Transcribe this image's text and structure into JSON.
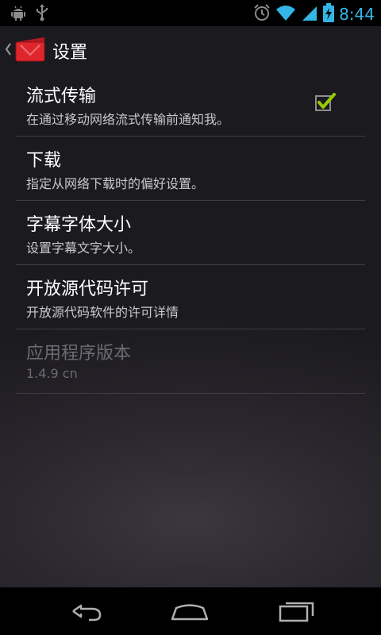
{
  "status_bar": {
    "left_icons": [
      "android-debug-icon",
      "usb-icon"
    ],
    "right_icons": [
      "alarm-icon",
      "wifi-icon",
      "signal-icon",
      "battery-charging-icon"
    ],
    "time": "8:44",
    "time_color": "#33b5e5"
  },
  "action_bar": {
    "title": "设置",
    "app_icon": "movie-clapper-icon"
  },
  "preferences": [
    {
      "title": "流式传输",
      "summary": "在通过移动网络流式传输前通知我。",
      "checkbox": true,
      "checked": true
    },
    {
      "title": "下载",
      "summary": "指定从网络下载时的偏好设置。"
    },
    {
      "title": "字幕字体大小",
      "summary": "设置字幕文字大小。"
    },
    {
      "title": "开放源代码许可",
      "summary": "开放源代码软件的许可详情"
    },
    {
      "title": "应用程序版本",
      "summary": "1.4.9 cn",
      "disabled": true
    }
  ],
  "nav_bar": {
    "buttons": [
      "back-icon",
      "home-icon",
      "recent-apps-icon"
    ]
  },
  "colors": {
    "accent": "#33b5e5",
    "check": "#99cc00",
    "divider": "#3f3d44"
  }
}
